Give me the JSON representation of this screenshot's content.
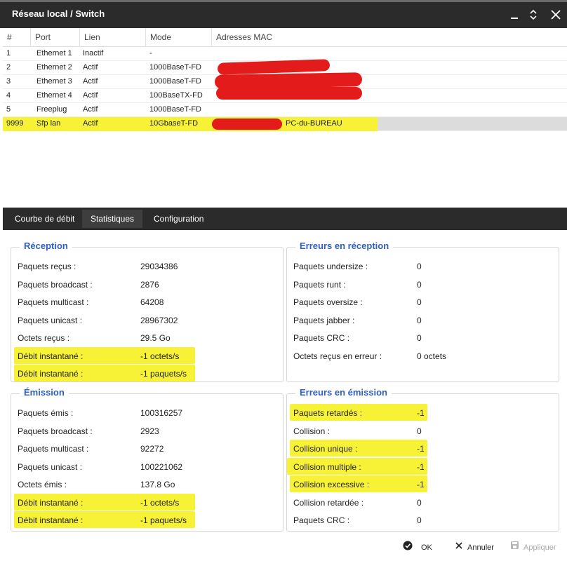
{
  "window": {
    "title": "Réseau local / Switch"
  },
  "table": {
    "headers": [
      "#",
      "Port",
      "Lien",
      "Mode",
      "Adresses MAC"
    ],
    "rows": [
      {
        "num": "1",
        "port": "Ethernet 1",
        "lien": "Inactif",
        "mode": "-",
        "mac": ""
      },
      {
        "num": "2",
        "port": "Ethernet 2",
        "lien": "Actif",
        "mode": "1000BaseT-FD",
        "mac": ""
      },
      {
        "num": "3",
        "port": "Ethernet 3",
        "lien": "Actif",
        "mode": "1000BaseT-FD",
        "mac": ""
      },
      {
        "num": "4",
        "port": "Ethernet 4",
        "lien": "Actif",
        "mode": "100BaseTX-FD",
        "mac": ""
      },
      {
        "num": "5",
        "port": "Freeplug",
        "lien": "Actif",
        "mode": "1000BaseT-FD",
        "mac": ""
      },
      {
        "num": "9999",
        "port": "Sfp lan",
        "lien": "Actif",
        "mode": "10GbaseT-FD",
        "mac": "PC-du-BUREAU"
      }
    ]
  },
  "tabs": [
    "Courbe de débit",
    "Statistiques",
    "Configuration"
  ],
  "panels": {
    "reception": {
      "title": "Réception",
      "items": [
        {
          "label": "Paquets reçus :",
          "value": "29034386"
        },
        {
          "label": "Paquets broadcast :",
          "value": "2876"
        },
        {
          "label": "Paquets multicast :",
          "value": "64208"
        },
        {
          "label": "Paquets unicast :",
          "value": "28967302"
        },
        {
          "label": "Octets reçus :",
          "value": "29.5 Go"
        },
        {
          "label": "Débit instantané :",
          "value": "-1 octets/s"
        },
        {
          "label": "Débit instantané :",
          "value": "-1 paquets/s"
        }
      ]
    },
    "reception_errors": {
      "title": "Erreurs en réception",
      "items": [
        {
          "label": "Paquets undersize :",
          "value": "0"
        },
        {
          "label": "Paquets runt :",
          "value": "0"
        },
        {
          "label": "Paquets oversize :",
          "value": "0"
        },
        {
          "label": "Paquets jabber :",
          "value": "0"
        },
        {
          "label": "Paquets CRC :",
          "value": "0"
        },
        {
          "label": "Octets reçus en erreur :",
          "value": "0 octets"
        }
      ]
    },
    "emission": {
      "title": "Émission",
      "items": [
        {
          "label": "Paquets émis :",
          "value": "100316257"
        },
        {
          "label": "Paquets broadcast :",
          "value": "2923"
        },
        {
          "label": "Paquets multicast :",
          "value": "92272"
        },
        {
          "label": "Paquets unicast :",
          "value": "100221062"
        },
        {
          "label": "Octets émis :",
          "value": "137.8 Go"
        },
        {
          "label": "Débit instantané :",
          "value": "-1 octets/s"
        },
        {
          "label": "Débit instantané :",
          "value": "-1 paquets/s"
        }
      ]
    },
    "emission_errors": {
      "title": "Erreurs en émission",
      "items": [
        {
          "label": "Paquets retardés :",
          "value": "-1"
        },
        {
          "label": "Collision :",
          "value": "0"
        },
        {
          "label": "Collision unique :",
          "value": "-1"
        },
        {
          "label": "Collision multiple :",
          "value": "-1"
        },
        {
          "label": "Collision excessive :",
          "value": "-1"
        },
        {
          "label": "Collision retardée :",
          "value": "0"
        },
        {
          "label": "Paquets CRC :",
          "value": "0"
        }
      ]
    }
  },
  "footer": {
    "ok": "OK",
    "cancel": "Annuler",
    "apply": "Appliquer"
  },
  "colors": {
    "titlebar": "#2b2b2b",
    "legend": "#2f5fc4",
    "highlight": "#f7f236",
    "redaction": "#e41b1b"
  },
  "icons": [
    "minimize-icon",
    "expand-collapse-icon",
    "close-icon",
    "check-circle-icon",
    "cancel-x-icon",
    "save-icon"
  ]
}
